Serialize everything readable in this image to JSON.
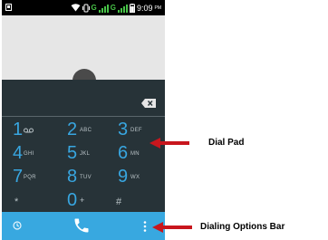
{
  "status_bar": {
    "time": "9:09",
    "ampm": "PM",
    "network_label_1": "G",
    "network_label_2": "G"
  },
  "icons": {
    "voicemail": "voicemail-icon",
    "backspace": "backspace-icon",
    "recent": "clock-icon",
    "call": "phone-icon",
    "more": "more-vert-icon",
    "favorites": "star-icon",
    "avatar": "person-avatar-icon"
  },
  "dialpad": {
    "keys": [
      {
        "number": "1",
        "letters": ""
      },
      {
        "number": "2",
        "letters": "ABC"
      },
      {
        "number": "3",
        "letters": "DEF"
      },
      {
        "number": "4",
        "letters": "GHI"
      },
      {
        "number": "5",
        "letters": "JKL"
      },
      {
        "number": "6",
        "letters": "MN"
      },
      {
        "number": "7",
        "letters": "PQR"
      },
      {
        "number": "8",
        "letters": "TUV"
      },
      {
        "number": "9",
        "letters": "WX"
      },
      {
        "number": "*",
        "letters": ""
      },
      {
        "number": "0",
        "letters": "+"
      },
      {
        "number": "#",
        "letters": ""
      }
    ]
  },
  "annotations": {
    "dial_pad": "Dial Pad",
    "options_bar": "Dialing Options Bar"
  },
  "colors": {
    "accent_blue": "#38a6e0",
    "options_bar": "#38a8e0",
    "dialpad_bg": "#273338",
    "contacts_bg": "#e6e6e6",
    "arrow_red": "#c8161d"
  }
}
